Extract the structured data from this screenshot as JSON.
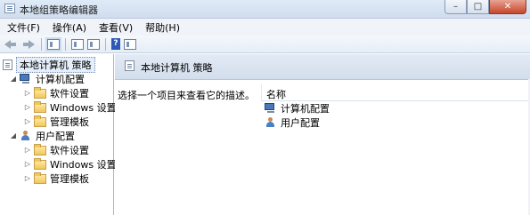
{
  "window": {
    "title": "本地组策略编辑器",
    "controls": {
      "minimize": "–",
      "maximize": "□",
      "close": "✕"
    }
  },
  "menu": [
    "文件(F)",
    "操作(A)",
    "查看(V)",
    "帮助(H)"
  ],
  "toolbar": {
    "buttons": [
      "back-icon",
      "forward-icon",
      "show-hide-tree-icon",
      "properties-icon",
      "export-list-icon",
      "help-icon",
      "extended-view-icon"
    ],
    "help_label": "?"
  },
  "tree": {
    "root": "本地计算机 策略",
    "computer_config": "计算机配置",
    "user_config": "用户配置",
    "computer_children": [
      "软件设置",
      "Windows 设置",
      "管理模板"
    ],
    "user_children": [
      "软件设置",
      "Windows 设置",
      "管理模板"
    ],
    "expand_glyph": "◢",
    "collapse_glyph": "▷"
  },
  "right_pane": {
    "header_title": "本地计算机 策略",
    "description": "选择一个项目来查看它的描述。",
    "column_name": "名称",
    "items": [
      "计算机配置",
      "用户配置"
    ]
  }
}
